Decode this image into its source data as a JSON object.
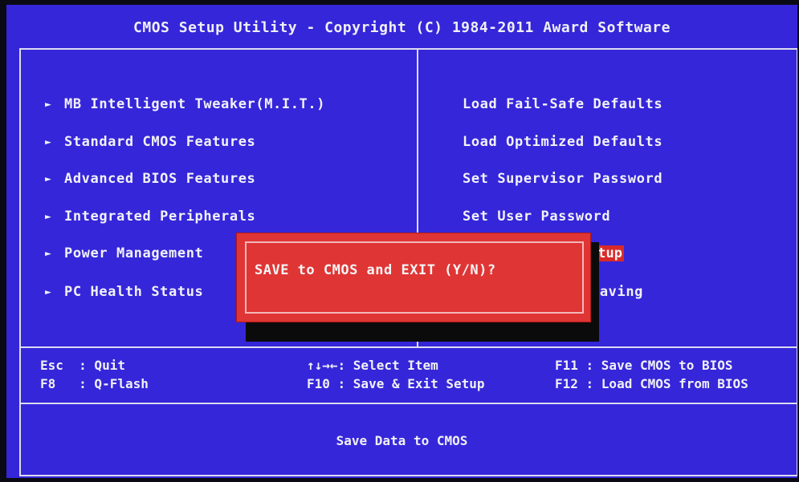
{
  "title": "CMOS Setup Utility - Copyright (C) 1984-2011 Award Software",
  "left_menu": [
    {
      "label": "MB Intelligent Tweaker(M.I.T.)",
      "arrow": "►"
    },
    {
      "label": "Standard CMOS Features",
      "arrow": "►"
    },
    {
      "label": "Advanced BIOS Features",
      "arrow": "►"
    },
    {
      "label": "Integrated Peripherals",
      "arrow": "►"
    },
    {
      "label": "Power Management",
      "arrow": "►"
    },
    {
      "label": "PC Health Status",
      "arrow": "►"
    }
  ],
  "right_menu": [
    {
      "label": "Load Fail-Safe Defaults"
    },
    {
      "label": "Load Optimized Defaults"
    },
    {
      "label": "Set Supervisor Password"
    },
    {
      "label": "Set User Password"
    },
    {
      "label": "etup",
      "selected": true
    },
    {
      "label": "Saving"
    }
  ],
  "help": {
    "esc": "Esc  : Quit",
    "f8": "F8   : Q-Flash",
    "select": "↑↓→←: Select Item",
    "f10": "F10 : Save & Exit Setup",
    "f11": "F11 : Save CMOS to BIOS",
    "f12": "F12 : Load CMOS from BIOS"
  },
  "status": "Save Data to CMOS",
  "dialog": {
    "message": "SAVE to CMOS and EXIT (Y/N)?"
  },
  "colors": {
    "background": "#3526d9",
    "dialog": "#e03535",
    "highlight": "#d82a2a",
    "text": "#f0f0f5"
  }
}
